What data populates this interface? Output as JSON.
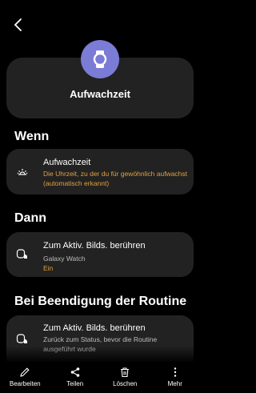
{
  "header": {
    "title": "Aufwachzeit",
    "hero_icon": "watch-icon"
  },
  "sections": {
    "wenn": {
      "title": "Wenn",
      "item": {
        "label": "Aufwachzeit",
        "description": "Die Uhrzeit, zu der du für gewöhnlich aufwachst (automatisch erkannt)",
        "icon": "sunrise-icon"
      }
    },
    "dann": {
      "title": "Dann",
      "item": {
        "label": "Zum Aktiv. Bilds. berühren",
        "device": "Galaxy Watch",
        "status": "Ein",
        "icon": "touch-watch-icon"
      }
    },
    "ende": {
      "title": "Bei Beendigung der Routine",
      "item": {
        "label": "Zum Aktiv. Bilds. berühren",
        "description": "Zurück zum Status, bevor die Routine ausgeführt wurde",
        "icon": "touch-watch-icon"
      }
    }
  },
  "bottom_bar": {
    "edit": "Bearbeiten",
    "share": "Teilen",
    "delete": "Löschen",
    "more": "Mehr"
  },
  "colors": {
    "accent": "#e4a13a",
    "hero": "#7b7cd6",
    "card": "#222222"
  }
}
